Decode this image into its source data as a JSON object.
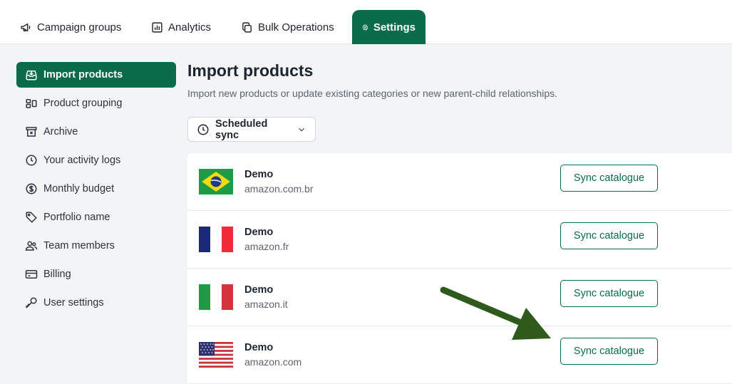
{
  "topnav": {
    "tabs": [
      {
        "label": "Campaign groups",
        "icon": "megaphone-icon"
      },
      {
        "label": "Analytics",
        "icon": "bar-chart-icon"
      },
      {
        "label": "Bulk Operations",
        "icon": "copy-icon"
      },
      {
        "label": "Settings",
        "icon": "gear-icon",
        "active": true
      }
    ]
  },
  "sidebar": {
    "items": [
      {
        "label": "Import products",
        "icon": "inbox-download-icon",
        "active": true
      },
      {
        "label": "Product grouping",
        "icon": "grouping-icon"
      },
      {
        "label": "Archive",
        "icon": "archive-icon"
      },
      {
        "label": "Your activity logs",
        "icon": "clock-icon"
      },
      {
        "label": "Monthly budget",
        "icon": "dollar-icon"
      },
      {
        "label": "Portfolio name",
        "icon": "tag-icon"
      },
      {
        "label": "Team members",
        "icon": "users-icon"
      },
      {
        "label": "Billing",
        "icon": "credit-card-icon"
      },
      {
        "label": "User settings",
        "icon": "key-icon"
      }
    ]
  },
  "main": {
    "title": "Import products",
    "description": "Import new products or update existing categories or new parent-child relationships.",
    "sync_dropdown": {
      "label": "Scheduled sync"
    },
    "accounts": [
      {
        "name": "Demo",
        "domain": "amazon.com.br",
        "flag": "brazil-flag-icon",
        "button": "Sync catalogue"
      },
      {
        "name": "Demo",
        "domain": "amazon.fr",
        "flag": "france-flag-icon",
        "button": "Sync catalogue"
      },
      {
        "name": "Demo",
        "domain": "amazon.it",
        "flag": "italy-flag-icon",
        "button": "Sync catalogue"
      },
      {
        "name": "Demo",
        "domain": "amazon.com",
        "flag": "usa-flag-icon",
        "button": "Sync catalogue"
      }
    ]
  },
  "colors": {
    "brand": "#0a6b4a",
    "arrow": "#2e5a1c",
    "background": "#f2f4f6"
  }
}
